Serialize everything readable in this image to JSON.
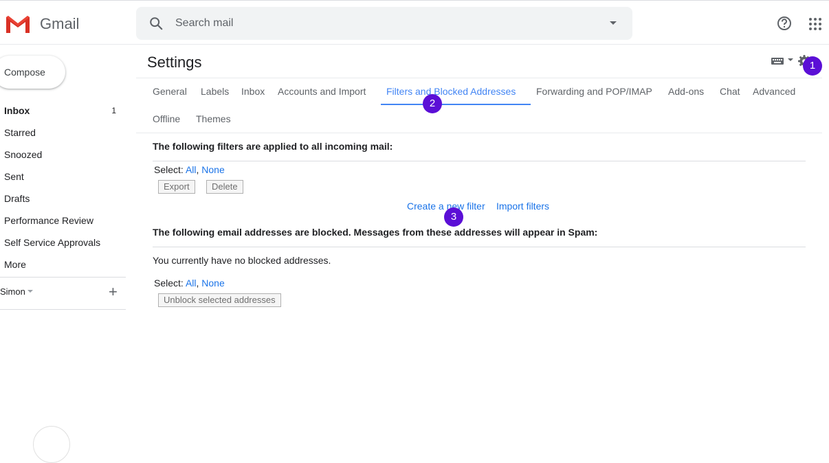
{
  "header": {
    "brand": "Gmail",
    "search_placeholder": "Search mail",
    "icons": [
      "gmail-logo-icon",
      "search-icon",
      "dropdown-caret-icon",
      "help-icon",
      "apps-grid-icon"
    ]
  },
  "sidebar": {
    "compose_label": "Compose",
    "items": [
      {
        "label": "Inbox",
        "count": "1",
        "bold": true
      },
      {
        "label": "Starred",
        "count": ""
      },
      {
        "label": "Snoozed",
        "count": ""
      },
      {
        "label": "Sent",
        "count": ""
      },
      {
        "label": "Drafts",
        "count": ""
      },
      {
        "label": "Performance Review",
        "count": ""
      },
      {
        "label": "Self Service Approvals",
        "count": ""
      },
      {
        "label": "More",
        "count": ""
      }
    ],
    "account_name": "Simon",
    "add_label": "+"
  },
  "settings": {
    "title": "Settings",
    "tabs": [
      {
        "label": "General"
      },
      {
        "label": "Labels"
      },
      {
        "label": "Inbox"
      },
      {
        "label": "Accounts and Import"
      },
      {
        "label": "Filters and Blocked Addresses",
        "active": true
      },
      {
        "label": "Forwarding and POP/IMAP"
      },
      {
        "label": "Add-ons"
      },
      {
        "label": "Chat"
      },
      {
        "label": "Advanced"
      },
      {
        "label": "Offline"
      },
      {
        "label": "Themes"
      }
    ],
    "filters_heading": "The following filters are applied to all incoming mail:",
    "select_label": "Select:",
    "select_all": "All",
    "select_sep": ",",
    "select_none": "None",
    "export_button": "Export",
    "delete_button": "Delete",
    "create_filter_link": "Create a new filter",
    "import_filters_link": "Import filters",
    "blocked_heading": "The following email addresses are blocked. Messages from these addresses will appear in Spam:",
    "no_blocked_text": "You currently have no blocked addresses.",
    "unblock_button": "Unblock selected addresses"
  },
  "markers": [
    "1",
    "2",
    "3"
  ],
  "colors": {
    "accent": "#4285f4",
    "link": "#1a73e8",
    "marker": "#5b0fd6"
  }
}
